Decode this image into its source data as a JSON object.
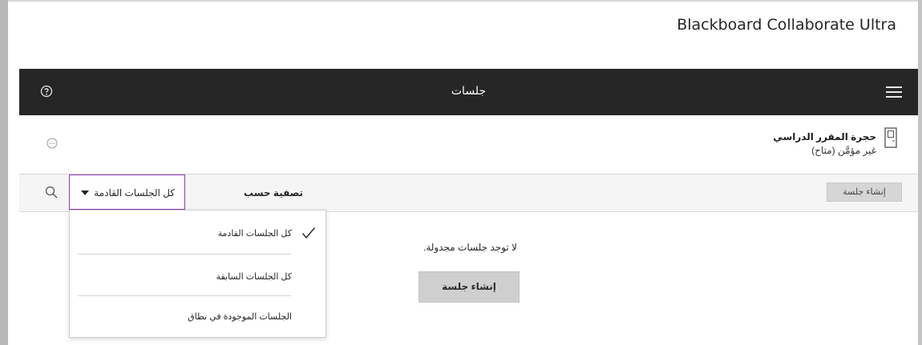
{
  "app": {
    "title": "Blackboard Collaborate Ultra"
  },
  "nav": {
    "title": "جلسات",
    "help_icon": "help-circle-icon",
    "menu_icon": "hamburger-menu-icon"
  },
  "room": {
    "title": "حجرة المقرر الدراسي",
    "status": "غير مؤمَّن (متاح)",
    "icon": "door-icon",
    "more_icon": "more-options-icon"
  },
  "filter": {
    "label": "تصفية حسب",
    "selected": "كل الجلسات القادمة",
    "search_icon": "search-icon",
    "create_button": "إنشاء جلسة",
    "options": [
      {
        "label": "كل الجلسات القادمة",
        "checked": true
      },
      {
        "label": "كل الجلسات السابقة",
        "checked": false
      },
      {
        "label": "الجلسات الموجودة في نطاق",
        "checked": false
      }
    ]
  },
  "empty": {
    "message": "لا توجد جلسات مجدولة.",
    "create_button": "إنشاء جلسة"
  }
}
